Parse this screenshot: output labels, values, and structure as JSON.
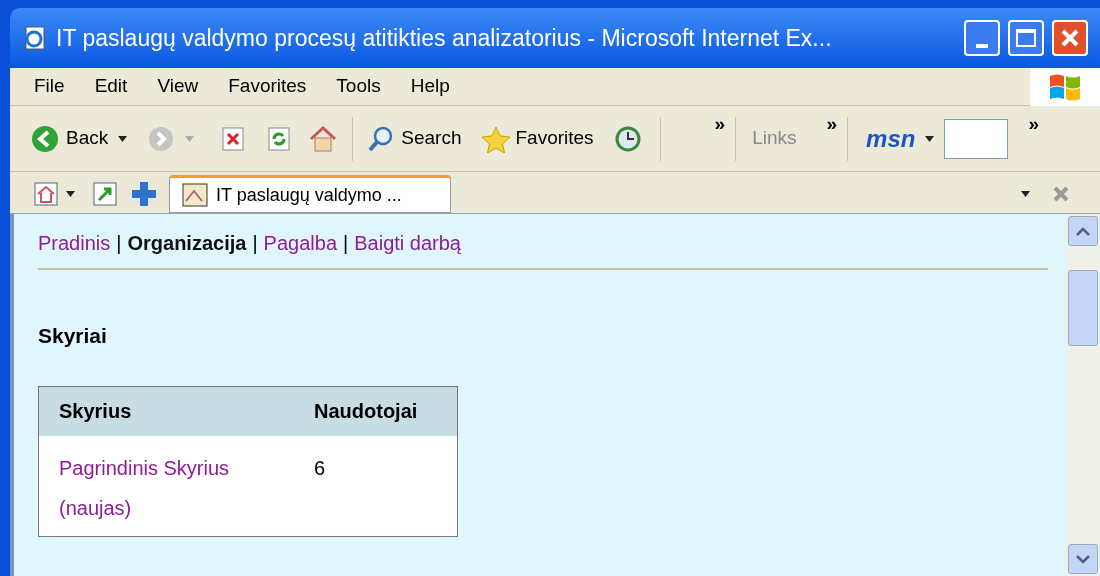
{
  "window": {
    "title": "IT paslaugų valdymo procesų atitikties analizatorius - Microsoft Internet Ex..."
  },
  "menu": [
    "File",
    "Edit",
    "View",
    "Favorites",
    "Tools",
    "Help"
  ],
  "toolbar": {
    "back": "Back",
    "search": "Search",
    "favorites": "Favorites",
    "overflow_1": "»",
    "links": "Links",
    "overflow_2": "»",
    "msn_logo": "msn",
    "overflow_3": "»"
  },
  "tab": {
    "title": "IT paslaugų valdymo ..."
  },
  "nav": [
    {
      "label": "Pradinis",
      "selected": false,
      "separator": "|"
    },
    {
      "label": "Organizacija",
      "selected": true,
      "separator": "|"
    },
    {
      "label": "Pagalba",
      "selected": false,
      "separator": "|"
    },
    {
      "label": "Baigti darbą",
      "selected": false
    }
  ],
  "heading": "Skyriai",
  "table": {
    "columns": [
      "Skyrius",
      "Naudotojai"
    ],
    "rows": [
      {
        "name": "Pagrindinis Skyrius (naujas)",
        "users": "6"
      }
    ]
  }
}
